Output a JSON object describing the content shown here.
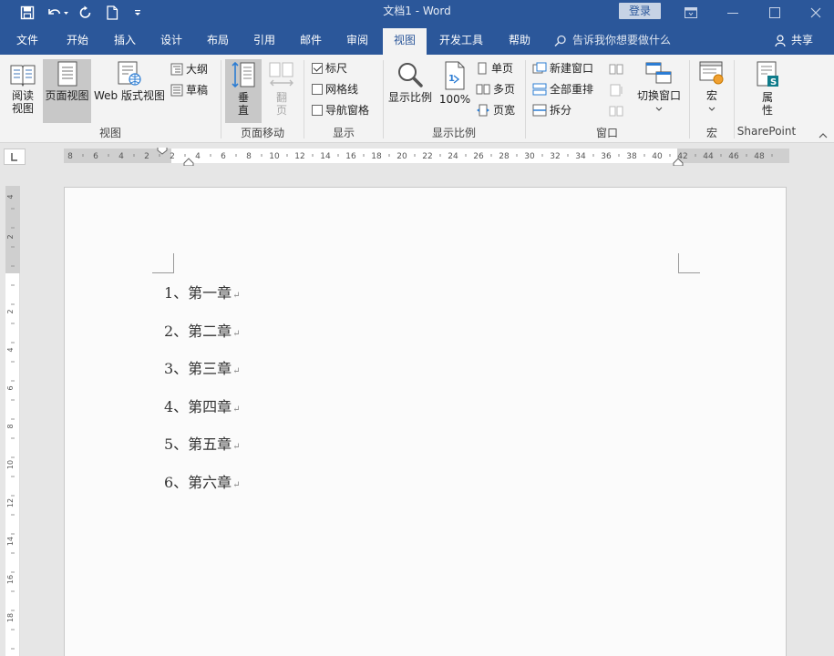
{
  "window": {
    "title": "文档1  -  Word",
    "login_label": "登录"
  },
  "tabs": [
    {
      "label": "文件"
    },
    {
      "label": "开始"
    },
    {
      "label": "插入"
    },
    {
      "label": "设计"
    },
    {
      "label": "布局"
    },
    {
      "label": "引用"
    },
    {
      "label": "邮件"
    },
    {
      "label": "审阅"
    },
    {
      "label": "视图",
      "active": true
    },
    {
      "label": "开发工具"
    },
    {
      "label": "帮助"
    }
  ],
  "tellme": {
    "placeholder": "告诉我你想要做什么"
  },
  "share": {
    "label": "共享"
  },
  "ribbon": {
    "views": {
      "read_mode": "阅读\n视图",
      "read_mode_l1": "阅读",
      "read_mode_l2": "视图",
      "print_layout": "页面视图",
      "web_layout": "Web 版式视图",
      "outline": "大纲",
      "draft": "草稿",
      "group": "视图"
    },
    "page_movement": {
      "vertical_l1": "垂",
      "vertical_l2": "直",
      "side_l1": "翻",
      "side_l2": "页",
      "group": "页面移动"
    },
    "show": {
      "ruler": "标尺",
      "ruler_checked": true,
      "gridlines": "网格线",
      "gridlines_checked": false,
      "nav_pane": "导航窗格",
      "nav_pane_checked": false,
      "group": "显示"
    },
    "zoom": {
      "zoom": "显示比例",
      "hundred": "100%",
      "one_page": "单页",
      "multi_page": "多页",
      "page_width": "页宽",
      "group": "显示比例"
    },
    "window": {
      "new_window": "新建窗口",
      "arrange_all": "全部重排",
      "split": "拆分",
      "switch_windows": "切换窗口",
      "group": "窗口"
    },
    "macros": {
      "label": "宏",
      "group": "宏"
    },
    "sharepoint": {
      "props_l1": "属",
      "props_l2": "性",
      "group": "SharePoint"
    }
  },
  "ruler": {
    "h_ticks": [
      "8",
      "6",
      "4",
      "2",
      "2",
      "4",
      "6",
      "8",
      "10",
      "12",
      "14",
      "16",
      "18",
      "20",
      "22",
      "24",
      "26",
      "28",
      "30",
      "32",
      "34",
      "36",
      "38",
      "40",
      "42",
      "44",
      "46",
      "48"
    ],
    "v_ticks": [
      "4",
      "2",
      "2",
      "4",
      "6",
      "8",
      "10",
      "12",
      "14",
      "16",
      "18"
    ]
  },
  "document": {
    "paragraphs": [
      "1、第一章",
      "2、第二章",
      "3、第三章",
      "4、第四章",
      "5、第五章",
      "6、第六章"
    ],
    "para_mark": "↵"
  },
  "colors": {
    "accent": "#2b579a",
    "ribbon_bg": "#f3f3f3",
    "canvas_bg": "#e6e6e6"
  }
}
